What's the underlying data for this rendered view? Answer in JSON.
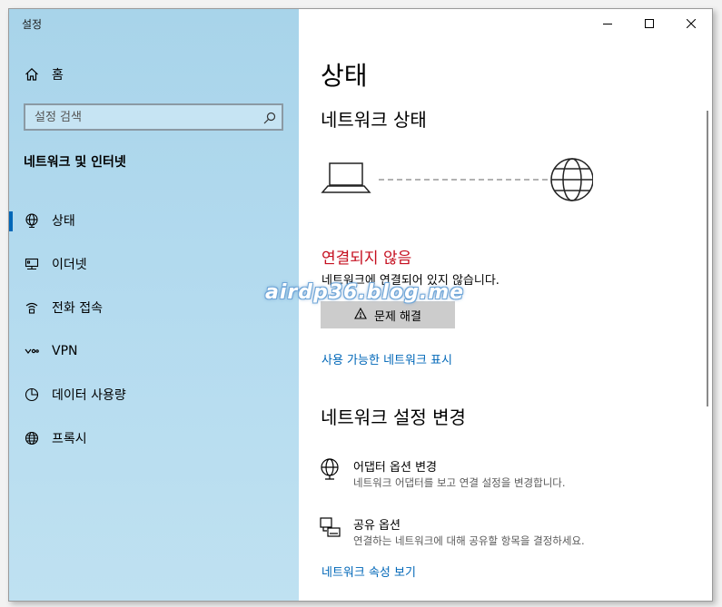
{
  "window": {
    "title": "설정"
  },
  "sidebar": {
    "home_label": "홈",
    "search_placeholder": "설정 검색",
    "section_title": "네트워크 및 인터넷",
    "items": [
      {
        "label": "상태",
        "icon": "globe-network-icon",
        "selected": true
      },
      {
        "label": "이더넷",
        "icon": "ethernet-icon",
        "selected": false
      },
      {
        "label": "전화 접속",
        "icon": "dialup-icon",
        "selected": false
      },
      {
        "label": "VPN",
        "icon": "vpn-icon",
        "selected": false
      },
      {
        "label": "데이터 사용량",
        "icon": "data-usage-icon",
        "selected": false
      },
      {
        "label": "프록시",
        "icon": "globe-icon",
        "selected": false
      }
    ],
    "accent_color": "#0067b8"
  },
  "main": {
    "page_title": "상태",
    "network_status_heading": "네트워크 상태",
    "status_text": "연결되지 않음",
    "status_color": "#c50f1f",
    "status_desc": "네트워크에 연결되어 있지 않습니다.",
    "troubleshoot_label": "문제 해결",
    "show_networks_link": "사용 가능한 네트워크 표시",
    "change_heading": "네트워크 설정 변경",
    "adapter": {
      "title": "어댑터 옵션 변경",
      "desc": "네트워크 어댑터를 보고 연결 설정을 변경합니다."
    },
    "sharing": {
      "title": "공유 옵션",
      "desc": "연결하는 네트워크에 대해 공유할 항목을 결정하세요."
    },
    "properties_link": "네트워크 속성 보기",
    "link_color": "#0067b8"
  },
  "watermark": "airdp36.blog.me"
}
